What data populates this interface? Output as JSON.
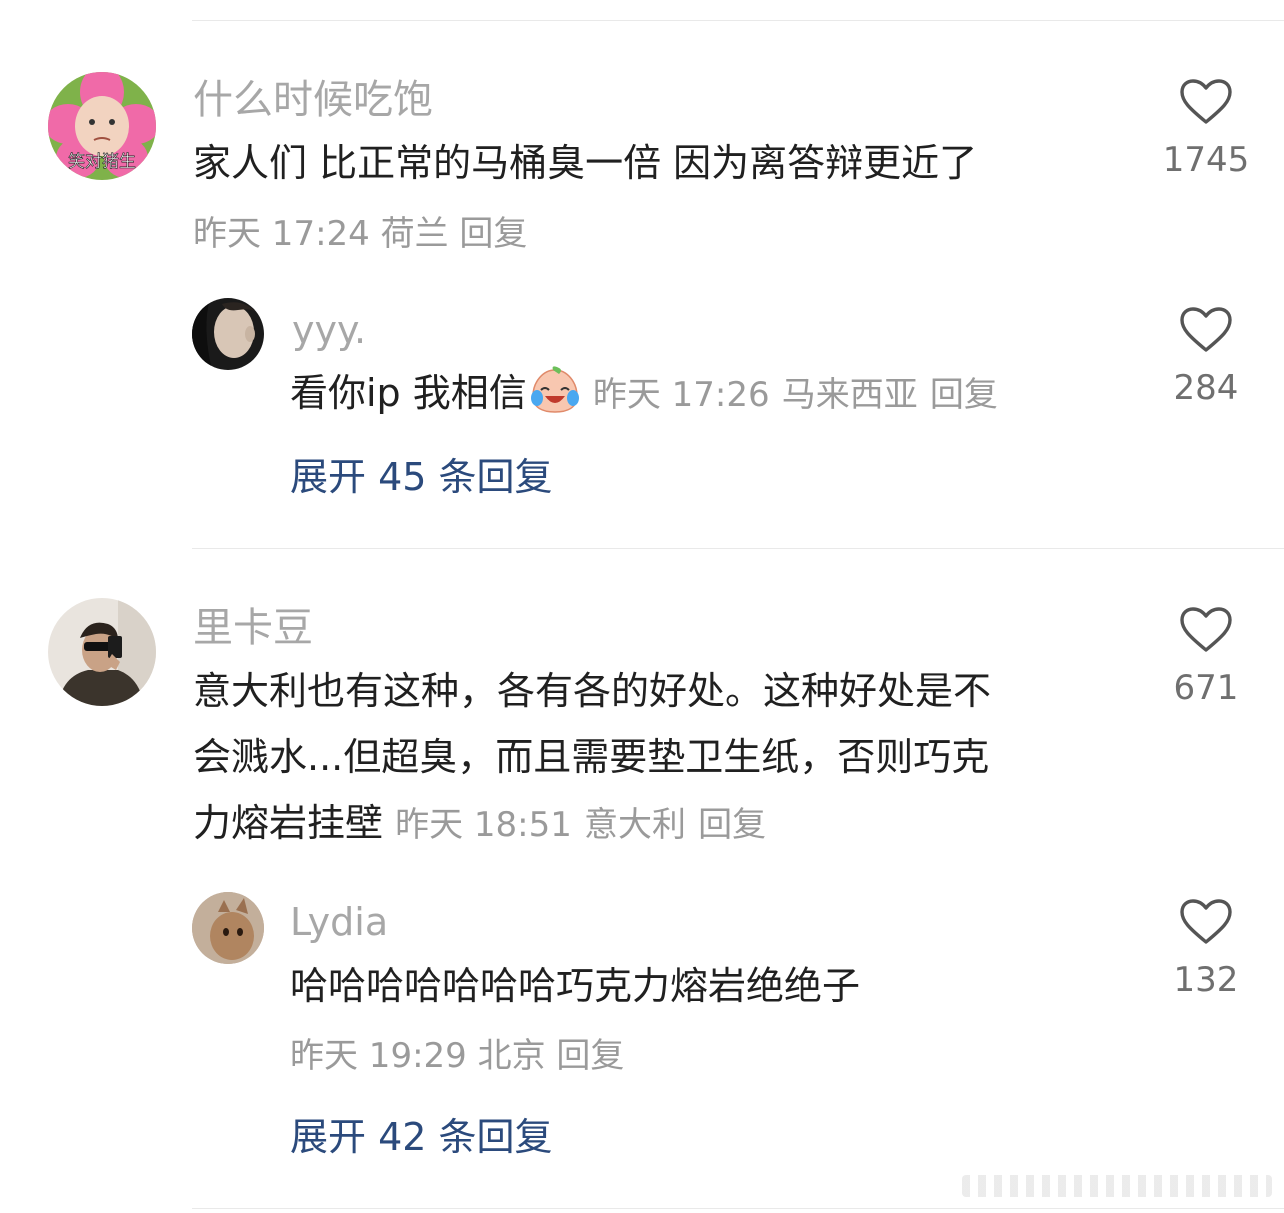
{
  "comments": [
    {
      "username": "什么时候吃饱",
      "avatar_text": "笑对猪生",
      "text": "家人们 比正常的马桶臭一倍 因为离答辩更近了",
      "time": "昨天 17:24",
      "location": "荷兰",
      "reply_label": "回复",
      "likes": "1745",
      "replies": [
        {
          "username": "yyy.",
          "text": "看你ip 我相信",
          "emoji": "crying-laughing-face-icon",
          "time": "昨天 17:26",
          "location": "马来西亚",
          "reply_label": "回复",
          "likes": "284"
        }
      ],
      "expand_label": "展开 45 条回复"
    },
    {
      "username": "里卡豆",
      "text_lines": [
        "意大利也有这种，各有各的好处。这种好处是不",
        "会溅水...但超臭，而且需要垫卫生纸，否则巧克",
        "力熔岩挂壁"
      ],
      "time": "昨天 18:51",
      "location": "意大利",
      "reply_label": "回复",
      "likes": "671",
      "replies": [
        {
          "username": "Lydia",
          "text": "哈哈哈哈哈哈哈巧克力熔岩绝绝子",
          "time": "昨天 19:29",
          "location": "北京",
          "reply_label": "回复",
          "likes": "132"
        }
      ],
      "expand_label": "展开 42 条回复"
    }
  ],
  "colors": {
    "link": "#2b4a7c",
    "muted": "#9a9a9a",
    "username": "#a7a7a7"
  }
}
